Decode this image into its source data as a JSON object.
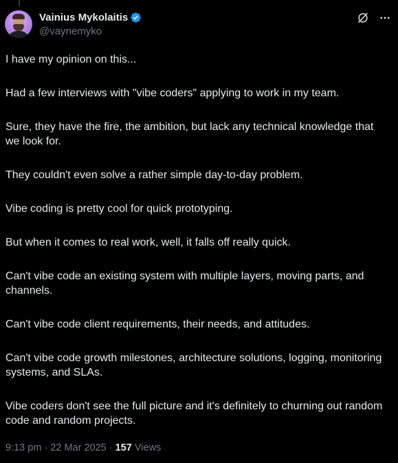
{
  "author": {
    "display_name": "Vainius Mykolaitis",
    "handle": "@vaynemyko",
    "verified_color": "#1d9bf0"
  },
  "icons": {
    "verified": "verified-badge-icon",
    "grok": "grok-icon",
    "more": "more-options-icon"
  },
  "tweet": {
    "paragraphs": [
      "I have my opinion on this...",
      "Had a few interviews with \"vibe coders\" applying to work in my team.",
      "Sure, they have the fire, the ambition, but lack any technical knowledge that we look for.",
      "They couldn't even solve a rather simple day-to-day problem.",
      "Vibe coding is pretty cool for quick prototyping.",
      "But when it comes to real work, well, it falls off really quick.",
      "Can't vibe code an existing system with multiple layers, moving parts, and channels.",
      "Can't vibe code client requirements, their needs, and attitudes.",
      "Can't vibe code growth milestones, architecture solutions, logging, monitoring systems, and SLAs.",
      "Vibe coders don't see the full picture and it's definitely to churning out random code and random projects."
    ]
  },
  "meta": {
    "time": "9:13 pm",
    "separator": "·",
    "date": "22 Mar 2025",
    "views_count": "157",
    "views_label": "Views"
  },
  "colors": {
    "background": "#000000",
    "text": "#e7e9ea",
    "secondary_text": "#71767b"
  }
}
